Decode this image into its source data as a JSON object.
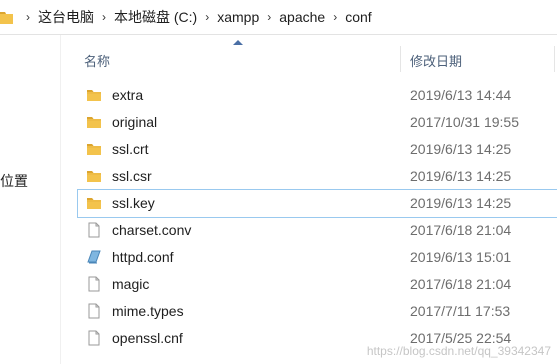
{
  "breadcrumb": [
    "这台电脑",
    "本地磁盘 (C:)",
    "xampp",
    "apache",
    "conf"
  ],
  "breadcrumb_separator": "›",
  "nav_pane": {
    "partial_label": "位置"
  },
  "columns": {
    "name": "名称",
    "date_modified": "修改日期"
  },
  "files": [
    {
      "name": "extra",
      "modified": "2019/6/13 14:44",
      "type": "folder"
    },
    {
      "name": "original",
      "modified": "2017/10/31 19:55",
      "type": "folder"
    },
    {
      "name": "ssl.crt",
      "modified": "2019/6/13 14:25",
      "type": "folder"
    },
    {
      "name": "ssl.csr",
      "modified": "2019/6/13 14:25",
      "type": "folder"
    },
    {
      "name": "ssl.key",
      "modified": "2019/6/13 14:25",
      "type": "folder",
      "selected": true
    },
    {
      "name": "charset.conv",
      "modified": "2017/6/18 21:04",
      "type": "file"
    },
    {
      "name": "httpd.conf",
      "modified": "2019/6/13 15:01",
      "type": "conf-file"
    },
    {
      "name": "magic",
      "modified": "2017/6/18 21:04",
      "type": "file"
    },
    {
      "name": "mime.types",
      "modified": "2017/7/11 17:53",
      "type": "file"
    },
    {
      "name": "openssl.cnf",
      "modified": "2017/5/25 22:54",
      "type": "file"
    }
  ],
  "watermark": "https://blog.csdn.net/qq_39342347",
  "colors": {
    "folder": "#f3c34c",
    "folder_dark": "#dca52f",
    "selection_border": "#99c9ef",
    "header_text": "#4c607a",
    "date_text": "#6d6d6d"
  }
}
